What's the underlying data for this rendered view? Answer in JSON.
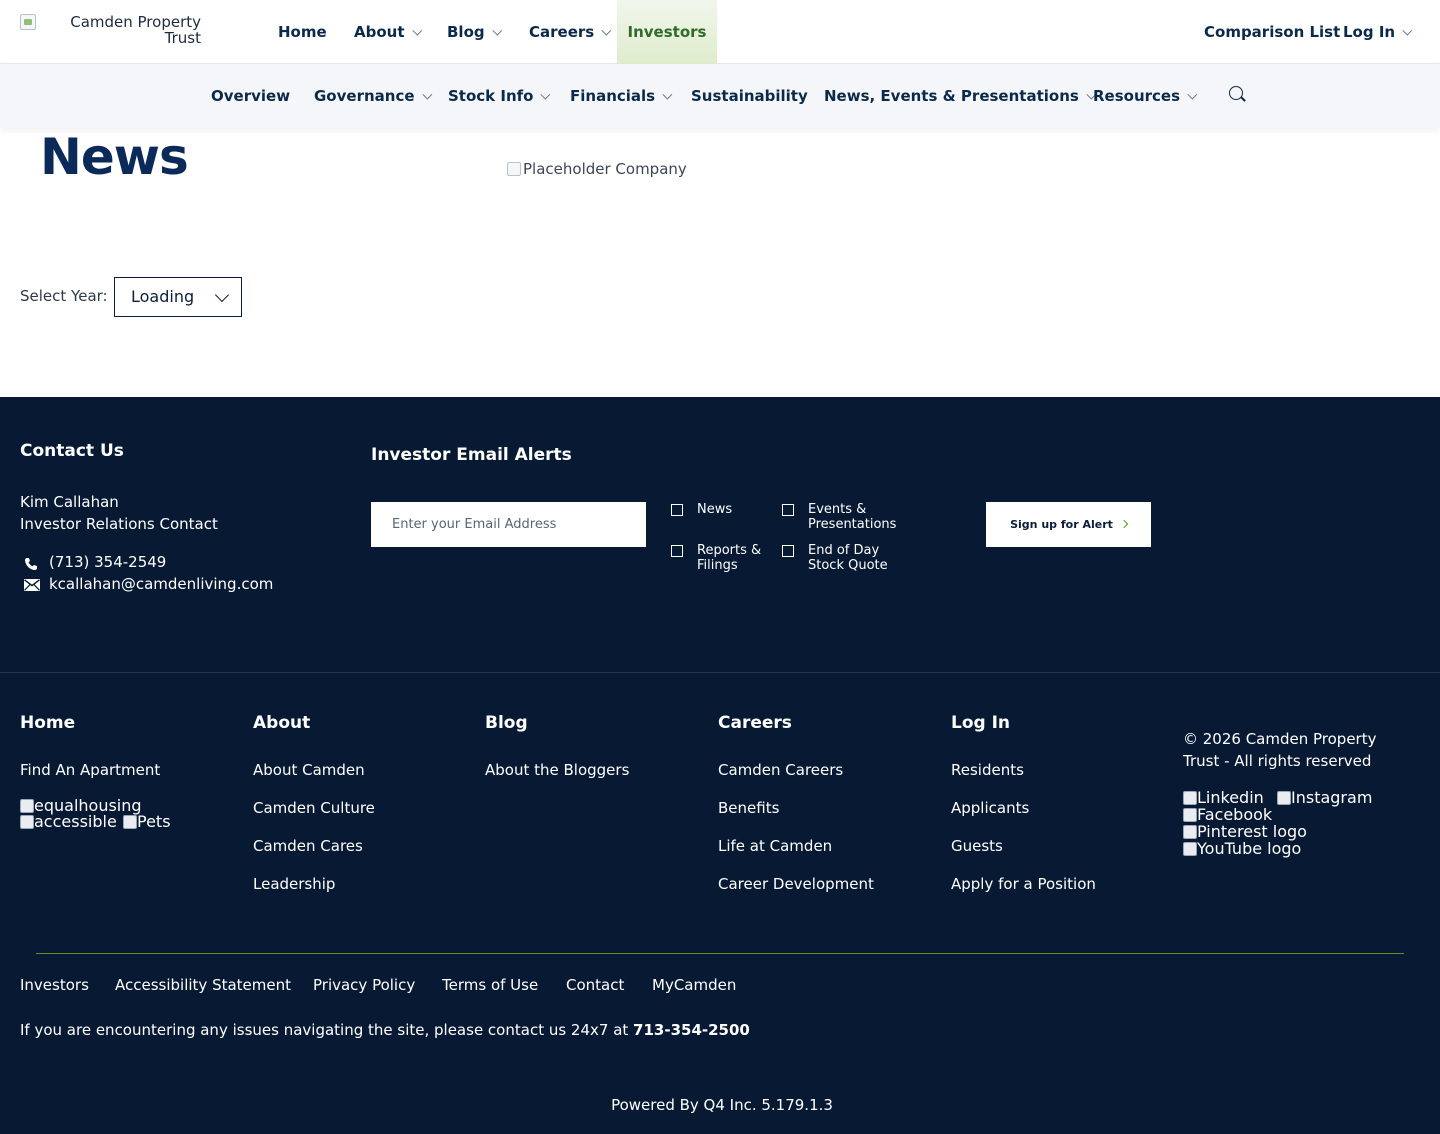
{
  "header": {
    "logo_alt": "Camden Property Trust",
    "nav": [
      {
        "label": "Home",
        "has_menu": false
      },
      {
        "label": "About",
        "has_menu": true
      },
      {
        "label": "Blog",
        "has_menu": true
      },
      {
        "label": "Careers",
        "has_menu": true
      },
      {
        "label": "Investors",
        "has_menu": false,
        "active": true
      }
    ],
    "comparison_list": "Comparison List",
    "login": "Log In"
  },
  "subnav": {
    "items": [
      {
        "label": "Overview",
        "has_menu": false
      },
      {
        "label": "Governance",
        "has_menu": true
      },
      {
        "label": "Stock Info",
        "has_menu": true
      },
      {
        "label": "Financials",
        "has_menu": true
      },
      {
        "label": "Sustainability",
        "has_menu": false
      },
      {
        "label": "News, Events & Presentations",
        "has_menu": true
      },
      {
        "label": "Resources",
        "has_menu": true
      }
    ],
    "search_icon": "search-icon"
  },
  "main": {
    "title": "News",
    "placeholder_image_alt": "Placeholder Company",
    "year_label": "Select Year:",
    "year_value": "Loading"
  },
  "footer": {
    "contact": {
      "heading": "Contact Us",
      "name": "Kim Callahan",
      "role": "Investor Relations Contact",
      "phone": "(713) 354-2549",
      "email": "kcallahan@camdenliving.com"
    },
    "alerts": {
      "heading": "Investor Email Alerts",
      "email_placeholder": "Enter your Email Address",
      "options": [
        {
          "line1": "News",
          "line2": ""
        },
        {
          "line1": "Events &",
          "line2": "Presentations"
        },
        {
          "line1": "Reports &",
          "line2": "Filings"
        },
        {
          "line1": "End of Day",
          "line2": "Stock Quote"
        }
      ],
      "button": "Sign up for Alert"
    },
    "columns": [
      {
        "heading": "Home",
        "links": [
          "Find An Apartment"
        ]
      },
      {
        "heading": "About",
        "links": [
          "About Camden",
          "Camden Culture",
          "Camden Cares",
          "Leadership"
        ]
      },
      {
        "heading": "Blog",
        "links": [
          "About the Bloggers"
        ]
      },
      {
        "heading": "Careers",
        "links": [
          "Camden Careers",
          "Benefits",
          "Life at Camden",
          "Career Development"
        ]
      },
      {
        "heading": "Log In",
        "links": [
          "Residents",
          "Applicants",
          "Guests",
          "Apply for a Position"
        ]
      }
    ],
    "badges": [
      "equalhousing",
      "accessible",
      "Pets"
    ],
    "copyright_line1": "© 2026 Camden Property",
    "copyright_line2": "Trust - All rights reserved",
    "social": [
      "Linkedin",
      "Instagram",
      "Facebook",
      "Pinterest logo",
      "YouTube logo"
    ],
    "bottom_links": [
      "Investors",
      "Accessibility Statement",
      "Privacy Policy",
      "Terms of Use",
      "Contact",
      "MyCamden"
    ],
    "notice_text": "If you are encountering any issues navigating the site, please contact us 24x7 at ",
    "notice_phone": "713-354-2500",
    "powered_by": "Powered By Q4 Inc. 5.179.1.3"
  },
  "colors": {
    "navy": "#0b2a5a",
    "footer_bg": "#081a33",
    "active_tab_bg": "#dfeccd",
    "accent_green": "#5b9a2e"
  }
}
